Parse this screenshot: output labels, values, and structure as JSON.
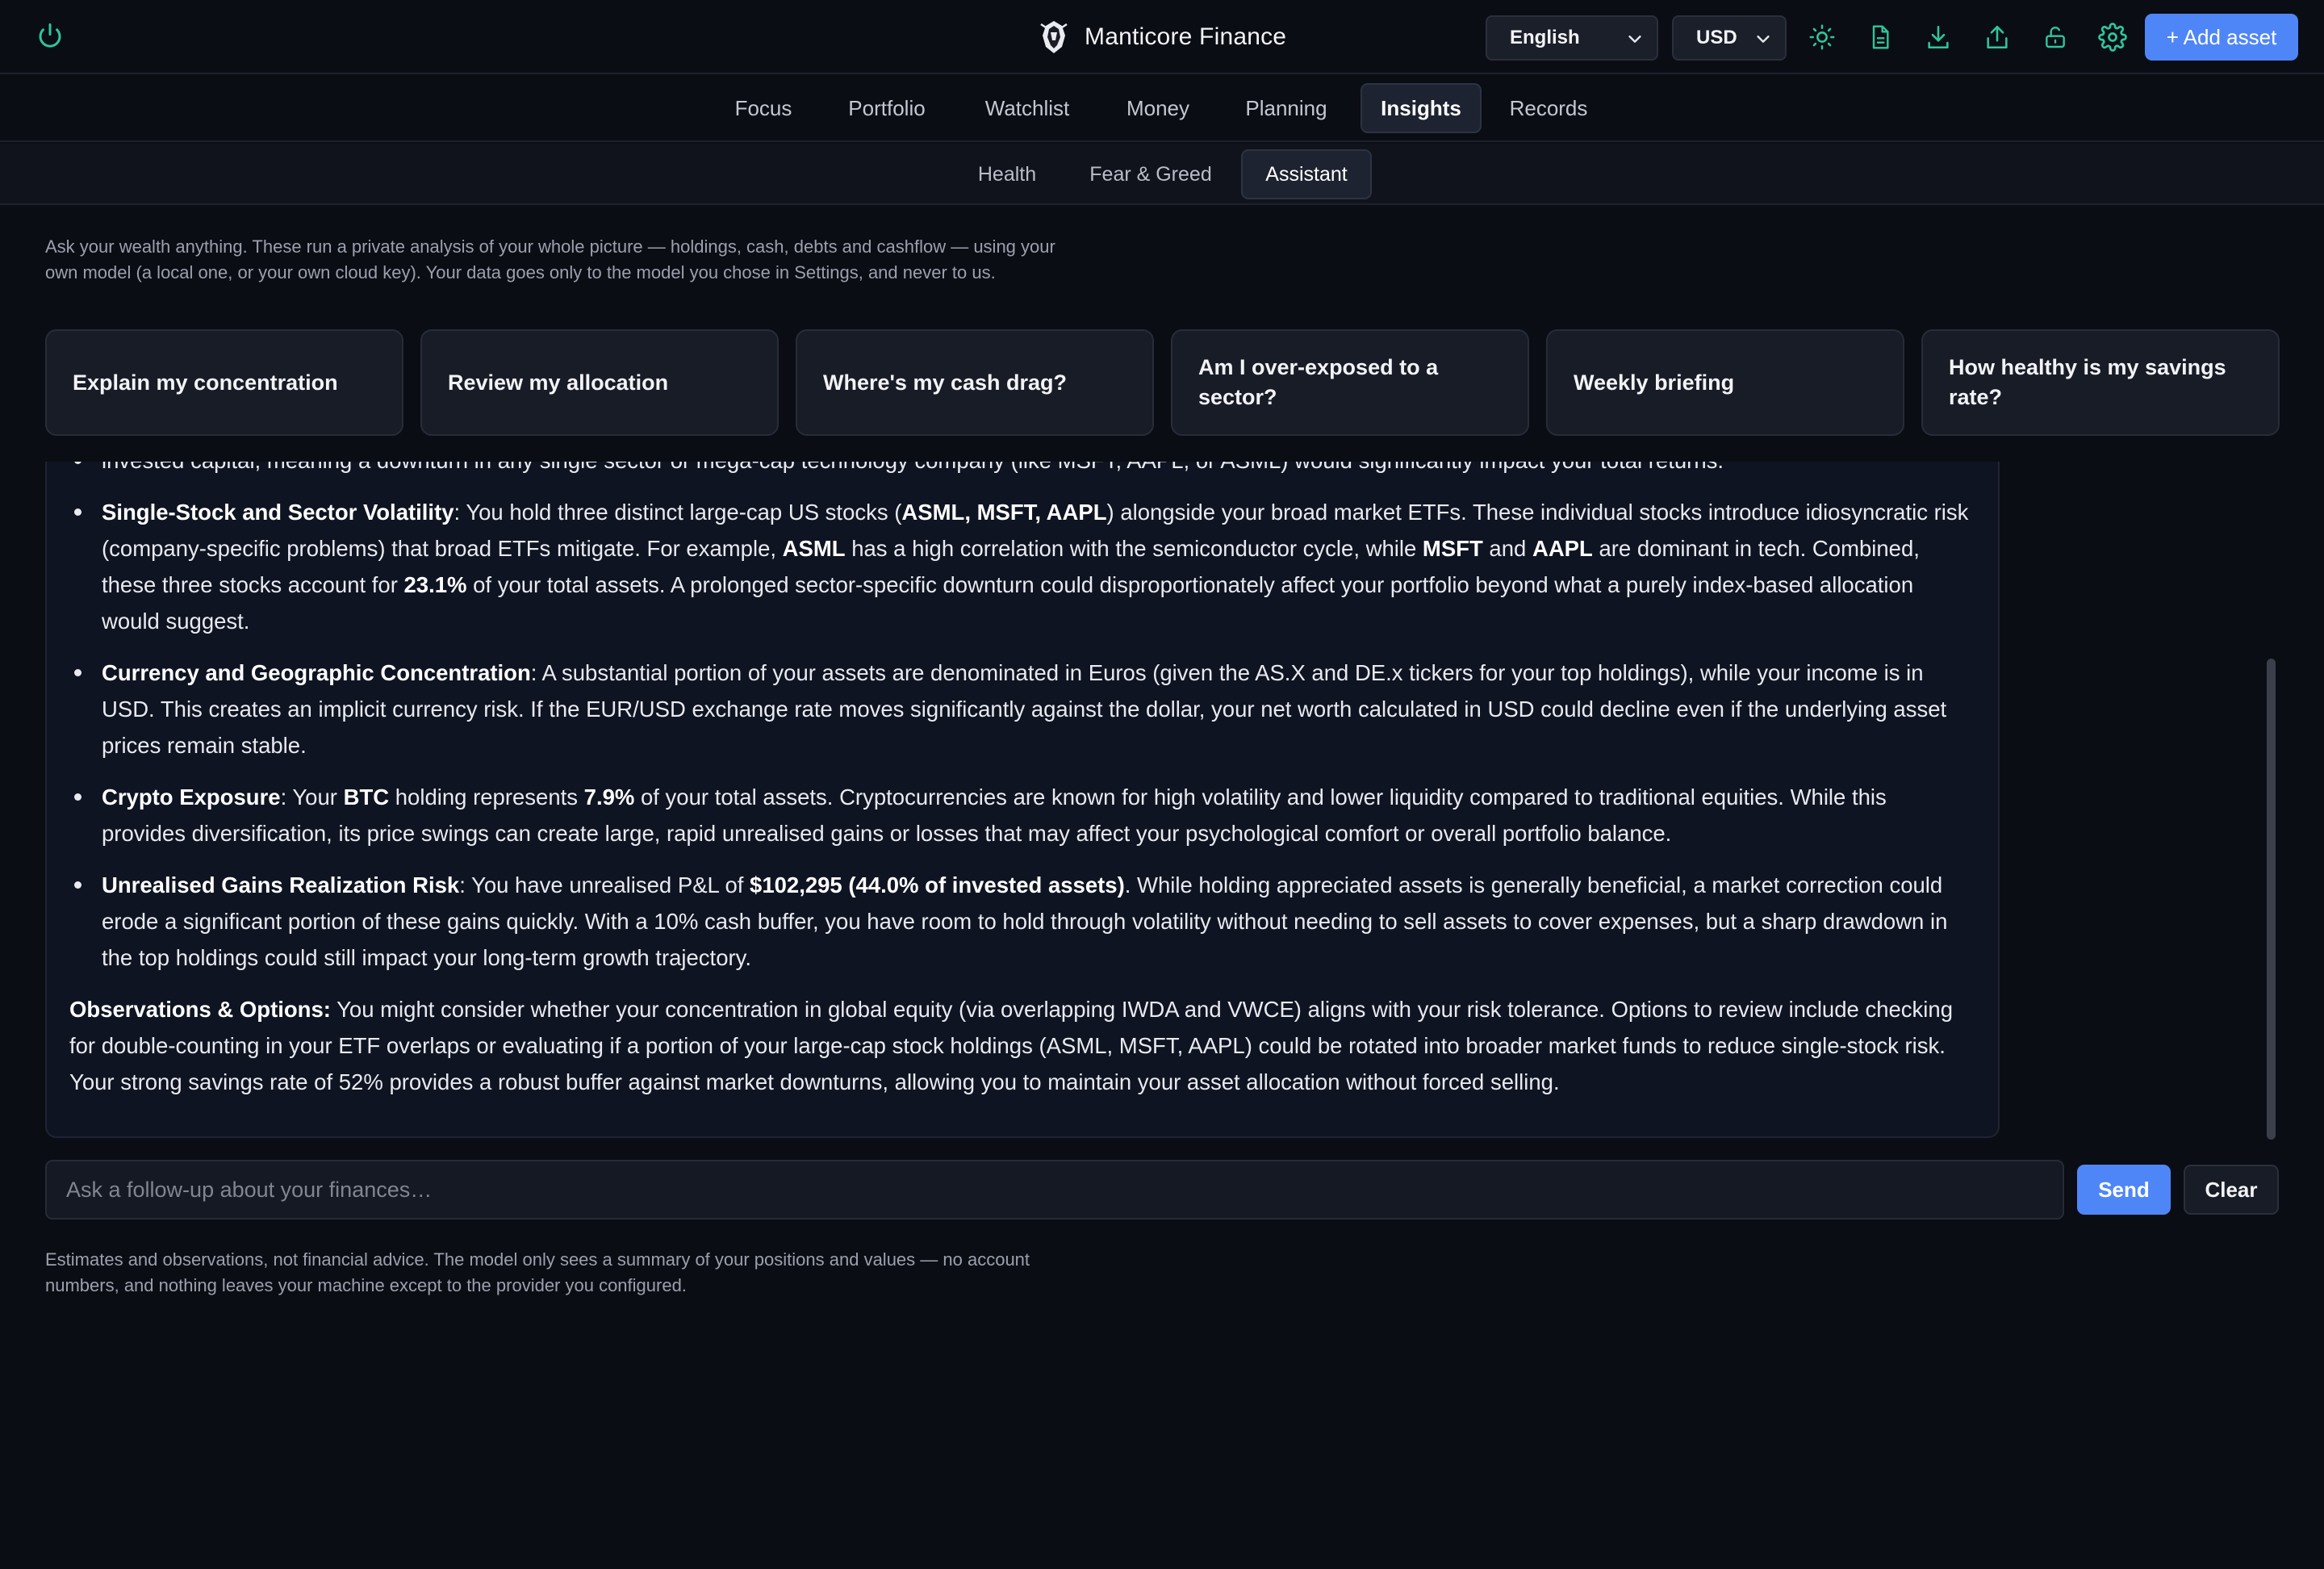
{
  "header": {
    "app_name": "Manticore Finance",
    "language": "English",
    "currency": "USD",
    "add_asset_label": "+ Add asset",
    "accent_color": "#2ec79a",
    "primary_color": "#4f86f7",
    "icons": [
      "power-icon",
      "sun-icon",
      "document-icon",
      "download-icon",
      "upload-icon",
      "lock-icon",
      "gear-icon"
    ]
  },
  "nav": {
    "tabs": [
      "Focus",
      "Portfolio",
      "Watchlist",
      "Money",
      "Planning",
      "Insights",
      "Records"
    ],
    "active": "Insights"
  },
  "subnav": {
    "tabs": [
      "Health",
      "Fear & Greed",
      "Assistant"
    ],
    "active": "Assistant"
  },
  "assistant": {
    "intro": "Ask your wealth anything. These run a private analysis of your whole picture — holdings, cash, debts and cashflow — using your own model (a local one, or your own cloud key). Your data goes only to the model you chose in Settings, and never to us.",
    "prompts": [
      "Explain my concentration",
      "Review my allocation",
      "Where's my cash drag?",
      "Am I over-exposed to a sector?",
      "Weekly briefing",
      "How healthy is my savings rate?"
    ],
    "answer": {
      "lead_fragment": "invested capital, meaning a downturn in any single sector or mega-cap technology company (like MSFT, AAPL, or ASML) would significantly impact your total returns.",
      "bullets": [
        {
          "title": "Single-Stock and Sector Volatility",
          "p1": ": You hold three distinct large-cap US stocks (",
          "b1": "ASML, MSFT, AAPL",
          "p2": ") alongside your broad market ETFs. These individual stocks introduce idiosyncratic risk (company-specific problems) that broad ETFs mitigate. For example, ",
          "b2": "ASML",
          "p3": " has a high correlation with the semiconductor cycle, while ",
          "b3": "MSFT",
          "p4": " and ",
          "b4": "AAPL",
          "p5": " are dominant in tech. Combined, these three stocks account for ",
          "b5": "23.1%",
          "p6": " of your total assets. A prolonged sector-specific downturn could disproportionately affect your portfolio beyond what a purely index-based allocation would suggest."
        },
        {
          "title": "Currency and Geographic Concentration",
          "text": ": A substantial portion of your assets are denominated in Euros (given the AS.X and DE.x tickers for your top holdings), while your income is in USD. This creates an implicit currency risk. If the EUR/USD exchange rate moves significantly against the dollar, your net worth calculated in USD could decline even if the underlying asset prices remain stable."
        },
        {
          "title": "Crypto Exposure",
          "p1": ": Your ",
          "b1": "BTC",
          "p2": " holding represents ",
          "b2": "7.9%",
          "p3": " of your total assets. Cryptocurrencies are known for high volatility and lower liquidity compared to traditional equities. While this provides diversification, its price swings can create large, rapid unrealised gains or losses that may affect your psychological comfort or overall portfolio balance."
        },
        {
          "title": "Unrealised Gains Realization Risk",
          "p1": ": You have unrealised P&L of ",
          "b1": "$102,295 (44.0% of invested assets)",
          "p2": ". While holding appreciated assets is generally beneficial, a market correction could erode a significant portion of these gains quickly. With a 10% cash buffer, you have room to hold through volatility without needing to sell assets to cover expenses, but a sharp drawdown in the top holdings could still impact your long-term growth trajectory."
        }
      ],
      "observations_title": "Observations & Options:",
      "observations_text": " You might consider whether your concentration in global equity (via overlapping IWDA and VWCE) aligns with your risk tolerance. Options to review include checking for double-counting in your ETF overlaps or evaluating if a portion of your large-cap stock holdings (ASML, MSFT, AAPL) could be rotated into broader market funds to reduce single-stock risk. Your strong savings rate of 52% provides a robust buffer against market downturns, allowing you to maintain your asset allocation without forced selling."
    },
    "followup_placeholder": "Ask a follow-up about your finances…",
    "send_label": "Send",
    "clear_label": "Clear",
    "disclaimer": "Estimates and observations, not financial advice. The model only sees a summary of your positions and values — no account numbers, and nothing leaves your machine except to the provider you configured."
  }
}
